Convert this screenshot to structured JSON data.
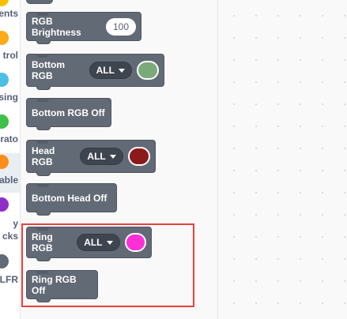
{
  "categories": [
    {
      "label": "ents",
      "color": "#ffbf00"
    },
    {
      "label": "trol",
      "color": "#ffab19"
    },
    {
      "label": "sing",
      "color": "#4cbfe6"
    },
    {
      "label": "rato",
      "color": "#40bf4a"
    },
    {
      "label": "able",
      "color": "#ff8c1a"
    },
    {
      "label": "y",
      "label2": "cks",
      "color": "#8e2fc8"
    },
    {
      "label": "LFR",
      "color": "#626a76"
    }
  ],
  "blocks": {
    "rgb_brightness": {
      "label": "RGB Brightness",
      "value": "100"
    },
    "bottom_rgb": {
      "label": "Bottom RGB",
      "dropdown": "ALL",
      "color": "#7aaa7a"
    },
    "bottom_rgb_off": {
      "label": "Bottom RGB Off"
    },
    "head_rgb": {
      "label": "Head RGB",
      "dropdown": "ALL",
      "color": "#8b1a1a"
    },
    "bottom_head_off": {
      "label": "Bottom Head Off"
    },
    "ring_rgb": {
      "label": "Ring RGB",
      "dropdown": "ALL",
      "color": "#ff2fd6"
    },
    "ring_rgb_off": {
      "label": "Ring RGB Off"
    }
  },
  "highlight_color": "#e8413b"
}
